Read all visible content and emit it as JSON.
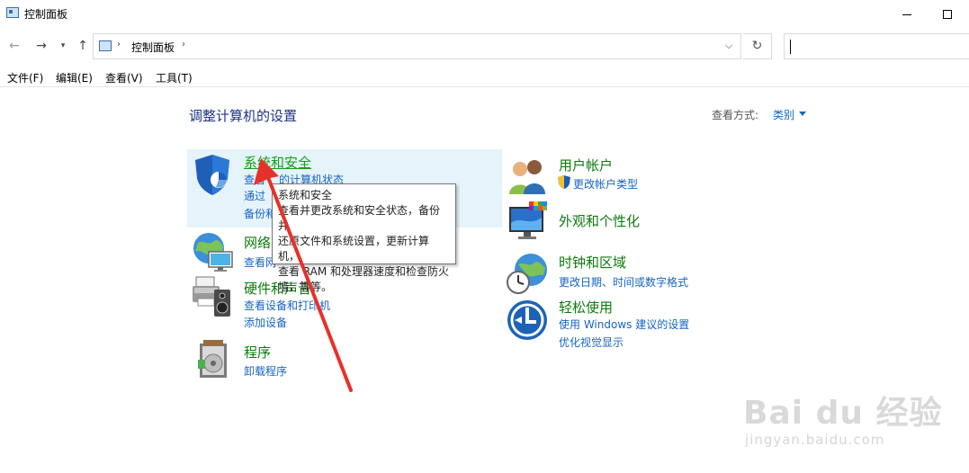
{
  "window": {
    "title": "控制面板"
  },
  "nav": {
    "breadcrumb": "控制面板",
    "separator": "›"
  },
  "menu": [
    "文件(F)",
    "编辑(E)",
    "查看(V)",
    "工具(T)"
  ],
  "content": {
    "title": "调整计算机的设置",
    "view_by_label": "查看方式:",
    "view_by_value": "类别"
  },
  "categories": {
    "system_security": {
      "title": "系统和安全",
      "links": [
        "查看你的计算机状态",
        "通过文件历史记录保存你的文件备份副本",
        "备份和还原(Windows 7)"
      ],
      "visible_links": [
        "查看",
        "的计算机状态",
        "通过",
        "系统和安全",
        "备份和"
      ]
    },
    "network": {
      "title": "网络",
      "link": "查看网"
    },
    "hardware": {
      "title": "硬件和声音",
      "links": [
        "查看设备和打印机",
        "添加设备"
      ]
    },
    "programs": {
      "title": "程序",
      "links": [
        "卸载程序"
      ]
    },
    "user_accounts": {
      "title": "用户帐户",
      "links": [
        "更改帐户类型"
      ]
    },
    "appearance": {
      "title": "外观和个性化"
    },
    "clock": {
      "title": "时钟和区域",
      "links": [
        "更改日期、时间或数字格式"
      ]
    },
    "ease": {
      "title": "轻松使用",
      "links": [
        "使用 Windows 建议的设置",
        "优化视觉显示"
      ]
    }
  },
  "tooltip": {
    "lines": [
      "系统和安全",
      "查看并更改系统和安全状态，备份并",
      "还原文件和系统设置，更新计算机，",
      "查看 RAM 和处理器速度和检查防火",
      "墙，等等。"
    ]
  },
  "watermark": {
    "main": "Bai du 经验",
    "sub": "jingyan.baidu.com"
  },
  "colors": {
    "link": "#1664c6",
    "category_title": "#0c7a0c",
    "annotation_arrow": "#e8302a"
  }
}
